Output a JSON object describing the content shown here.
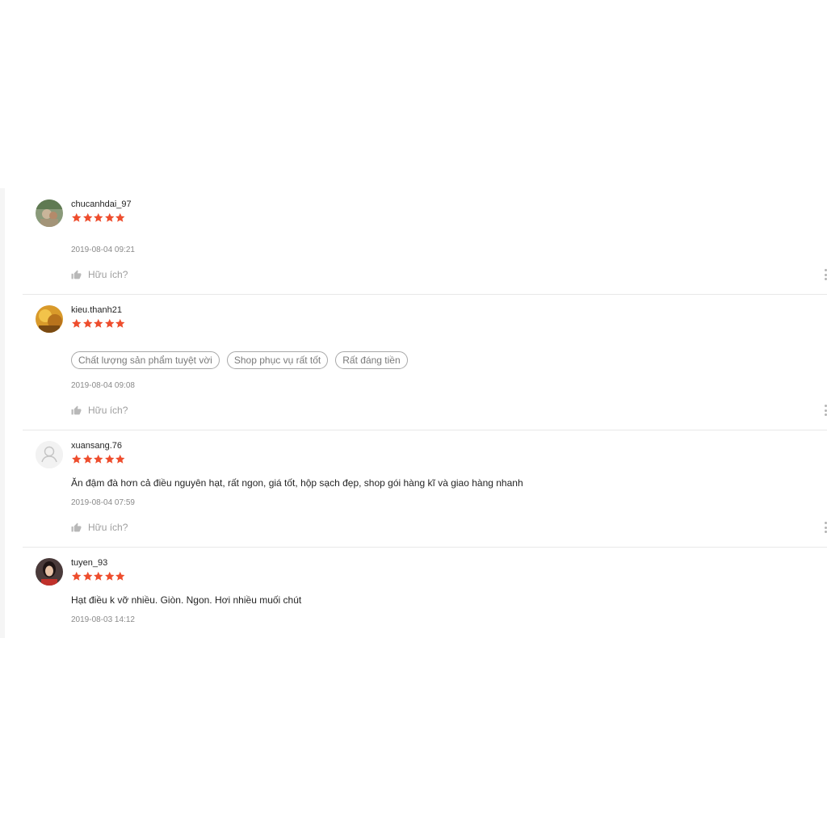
{
  "colors": {
    "star": "#ee4d2d",
    "tag_border": "#a8a8a8",
    "divider": "#e8e8e8"
  },
  "icons": {
    "helpful": "thumbs-up-icon",
    "more": "more-vertical-icon",
    "rating": "star-icon"
  },
  "reviews": [
    {
      "username": "chucanhdai_97",
      "rating": 5,
      "time": "2019-08-04 09:21",
      "helpful_label": "Hữu ích?"
    },
    {
      "username": "kieu.thanh21",
      "rating": 5,
      "tags": [
        "Chất lượng sản phẩm tuyệt vời",
        "Shop phục vụ rất tốt",
        "Rất đáng tiền"
      ],
      "time": "2019-08-04 09:08",
      "helpful_label": "Hữu ích?"
    },
    {
      "username": "xuansang.76",
      "rating": 5,
      "comment": "Ăn đậm đà hơn cả điều nguyên hạt, rất ngon, giá tốt, hộp sạch đẹp, shop gói hàng kĩ và giao hàng nhanh",
      "time": "2019-08-04 07:59",
      "helpful_label": "Hữu ích?"
    },
    {
      "username": "tuyen_93",
      "rating": 5,
      "comment": "Hạt điều k vỡ nhiều. Giòn. Ngon. Hơi nhiều muối chút",
      "time": "2019-08-03 14:12"
    }
  ]
}
